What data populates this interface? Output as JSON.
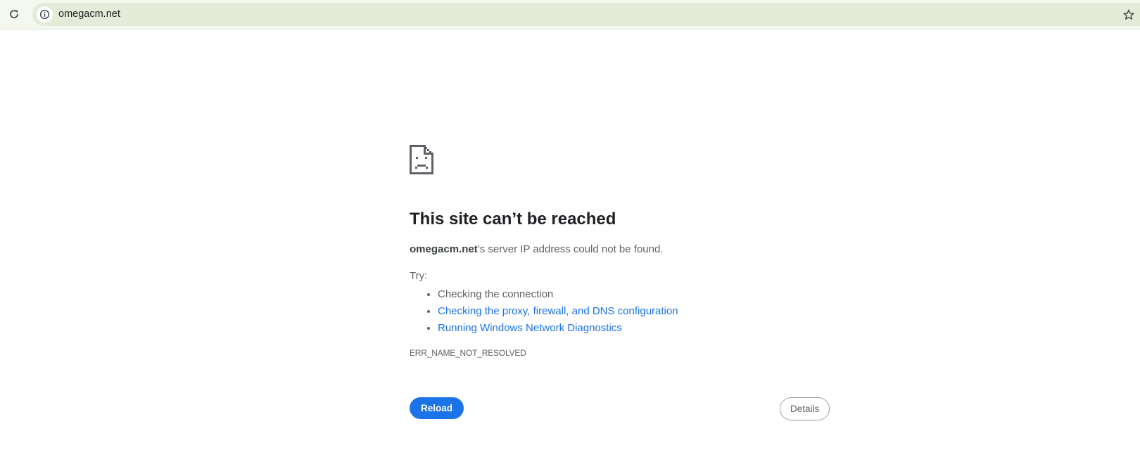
{
  "browser": {
    "url": "omegacm.net",
    "icons": {
      "reload": "reload-icon",
      "site_info": "info-icon",
      "bookmark": "star-icon"
    }
  },
  "error_page": {
    "icon": "sad-document-icon",
    "title": "This site can’t be reached",
    "host": "omegacm.net",
    "summary_suffix": "’s server IP address could not be found.",
    "try_label": "Try:",
    "suggestions": [
      {
        "text": "Checking the connection",
        "is_link": false
      },
      {
        "text": "Checking the proxy, firewall, and DNS configuration",
        "is_link": true
      },
      {
        "text": "Running Windows Network Diagnostics",
        "is_link": true
      }
    ],
    "error_code": "ERR_NAME_NOT_RESOLVED",
    "reload_label": "Reload",
    "details_label": "Details"
  },
  "colors": {
    "toolbar_bg": "#f4f8ee",
    "omnibox_bg": "#e4ecd9",
    "link": "#1a73e8",
    "primary_button": "#1a73e8",
    "heading_text": "#202124",
    "body_text": "#5f6368"
  }
}
